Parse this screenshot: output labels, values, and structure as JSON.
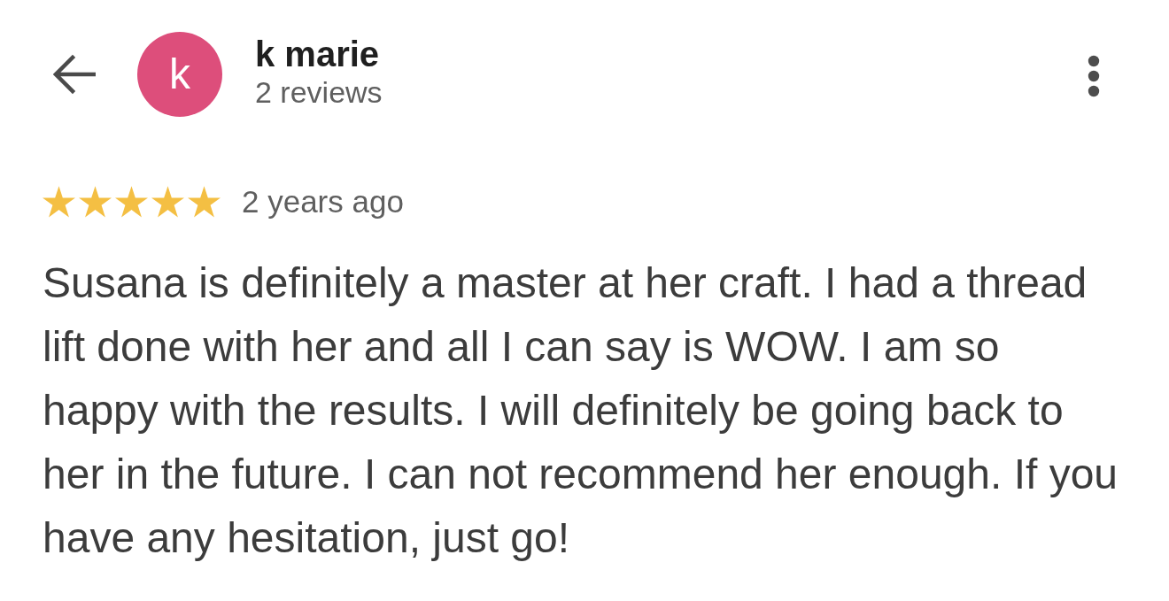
{
  "header": {
    "avatar_letter": "k",
    "user_name": "k marie",
    "review_count": "2 reviews"
  },
  "review": {
    "stars": 5,
    "time": "2 years ago",
    "text": "Susana is definitely a master at her craft. I had a thread lift done with her and all I can say is WOW. I am so happy with the results. I will definitely be going back to her in the future. I can not recommend her enough. If you have any hesitation, just go!"
  }
}
